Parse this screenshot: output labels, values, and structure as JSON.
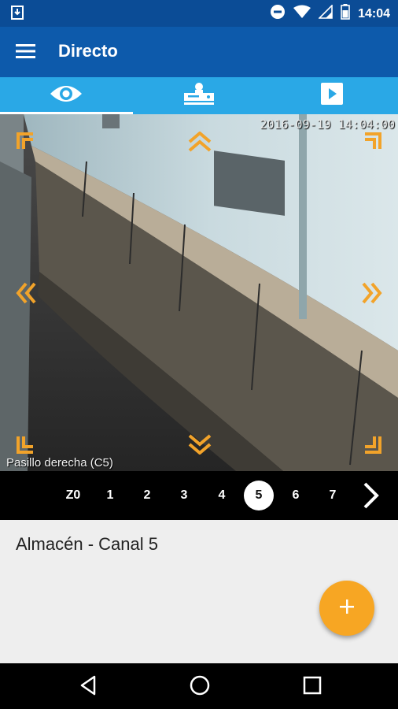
{
  "status_bar": {
    "time": "14:04",
    "icons": [
      "download-notification-icon",
      "do-not-disturb-icon",
      "wifi-icon",
      "signal-icon",
      "battery-icon"
    ]
  },
  "app_bar": {
    "menu_icon": "hamburger-menu-icon",
    "title": "Directo"
  },
  "tabs": [
    {
      "icon": "eye-icon",
      "active": true
    },
    {
      "icon": "recorder-device-icon",
      "active": false
    },
    {
      "icon": "play-icon",
      "active": false
    }
  ],
  "video": {
    "timestamp": "2016-09-19 14:04:00",
    "camera_name": "Pasillo derecha (C5)",
    "ptz_color": "#f2a32a"
  },
  "channels": {
    "items": [
      "Z0",
      "1",
      "2",
      "3",
      "4",
      "5",
      "6",
      "7"
    ],
    "active": "5",
    "next_icon": "chevron-right-icon"
  },
  "info": {
    "title": "Almacén - Canal 5",
    "fab_icon": "plus-icon",
    "fab_color": "#f7a623"
  },
  "nav": {
    "icons": [
      "back-icon",
      "home-icon",
      "recents-icon"
    ]
  }
}
